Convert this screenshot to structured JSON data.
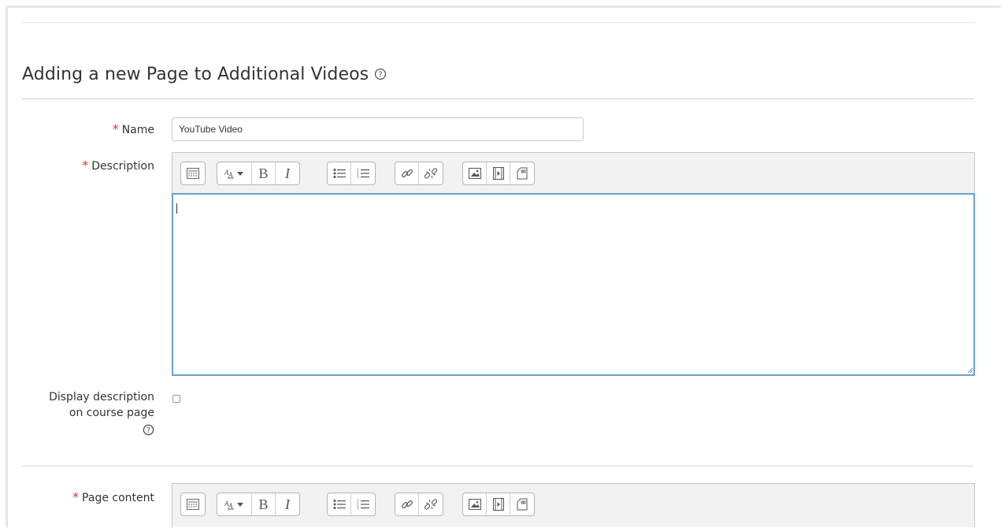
{
  "form": {
    "heading": "Adding a new Page to Additional Videos",
    "required_marker": "*",
    "name": {
      "label": "Name",
      "value": "YouTube Video"
    },
    "description": {
      "label": "Description",
      "value": ""
    },
    "display_description": {
      "label_line1": "Display description",
      "label_line2": "on course page",
      "checked": false
    },
    "page_content": {
      "label": "Page content"
    }
  },
  "toolbar": {
    "bold_label": "B",
    "italic_label": "I",
    "icons": [
      "show-more-buttons-icon",
      "font-style-icon",
      "bold-icon",
      "italic-icon",
      "unordered-list-icon",
      "ordered-list-icon",
      "link-icon",
      "unlink-icon",
      "image-icon",
      "media-icon",
      "manage-files-icon"
    ]
  },
  "colors": {
    "required": "#d9352d",
    "focus_border": "#68a3cf",
    "toolbar_bg": "#f2f2f2"
  }
}
